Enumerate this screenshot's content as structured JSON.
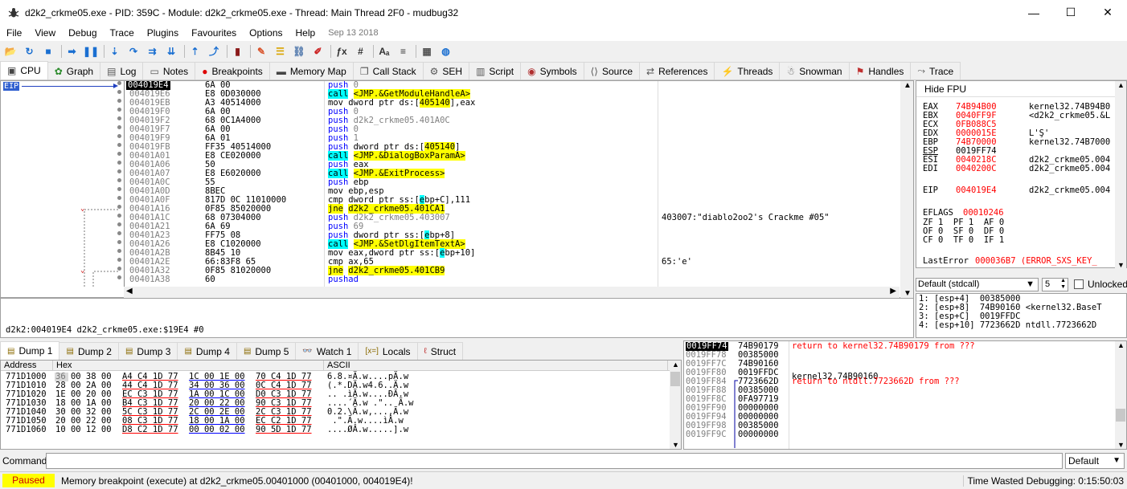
{
  "window": {
    "title": "d2k2_crkme05.exe - PID: 359C - Module: d2k2_crkme05.exe - Thread: Main Thread 2F0 - mudbug32",
    "min": "—",
    "max": "☐",
    "close": "✕"
  },
  "menu": [
    "File",
    "View",
    "Debug",
    "Trace",
    "Plugins",
    "Favourites",
    "Options",
    "Help"
  ],
  "menu_date": "Sep 13 2018",
  "toolbar": [
    {
      "name": "open-icon",
      "glyph": "📂",
      "color": "#d9a400"
    },
    {
      "name": "restart-icon",
      "glyph": "↻",
      "color": "#1a6fd1"
    },
    {
      "name": "stop-icon",
      "glyph": "■",
      "color": "#1a6fd1"
    },
    {
      "name": "run-icon",
      "glyph": "➡",
      "color": "#1a6fd1"
    },
    {
      "name": "pause-icon",
      "glyph": "❚❚",
      "color": "#1a6fd1"
    },
    {
      "name": "step-into-icon",
      "glyph": "⇣",
      "color": "#1a6fd1"
    },
    {
      "name": "step-over-icon",
      "glyph": "↷",
      "color": "#1a6fd1"
    },
    {
      "name": "trace-into-icon",
      "glyph": "⇉",
      "color": "#1a6fd1"
    },
    {
      "name": "trace-over-icon",
      "glyph": "⇊",
      "color": "#1a6fd1"
    },
    {
      "name": "execute-till-return-icon",
      "glyph": "⇡",
      "color": "#1a6fd1"
    },
    {
      "name": "run-to-user-code-icon",
      "glyph": "⤴",
      "color": "#1a6fd1"
    },
    {
      "name": "scylla-icon",
      "glyph": "▮",
      "color": "#8b1a1a"
    },
    {
      "name": "patch-icon",
      "glyph": "✎",
      "color": "#d9532b"
    },
    {
      "name": "comments-icon",
      "glyph": "☰",
      "color": "#d9a400"
    },
    {
      "name": "labels-icon",
      "glyph": "⛓",
      "color": "#5a7fb0"
    },
    {
      "name": "bookmarks-icon",
      "glyph": "✐",
      "color": "#cc2222"
    },
    {
      "name": "functions-icon",
      "glyph": "ƒx",
      "color": "#333"
    },
    {
      "name": "hash-icon",
      "glyph": "#",
      "color": "#333"
    },
    {
      "name": "font-icon",
      "glyph": "Aₐ",
      "color": "#333"
    },
    {
      "name": "list-icon",
      "glyph": "≡",
      "color": "#333"
    },
    {
      "name": "calculator-icon",
      "glyph": "▦",
      "color": "#555"
    },
    {
      "name": "globe-icon",
      "glyph": "◍",
      "color": "#1a6fd1"
    }
  ],
  "tabs": [
    {
      "label": "CPU",
      "icon": "cpu-icon",
      "glyph": "▣",
      "color": "#444",
      "active": true
    },
    {
      "label": "Graph",
      "icon": "graph-icon",
      "glyph": "✿",
      "color": "#2a8a2a"
    },
    {
      "label": "Log",
      "icon": "log-icon",
      "glyph": "▤",
      "color": "#555"
    },
    {
      "label": "Notes",
      "icon": "notes-icon",
      "glyph": "▭",
      "color": "#555"
    },
    {
      "label": "Breakpoints",
      "icon": "breakpoint-icon",
      "glyph": "●",
      "color": "#d00"
    },
    {
      "label": "Memory Map",
      "icon": "memory-map-icon",
      "glyph": "▬",
      "color": "#444"
    },
    {
      "label": "Call Stack",
      "icon": "call-stack-icon",
      "glyph": "❐",
      "color": "#555"
    },
    {
      "label": "SEH",
      "icon": "seh-icon",
      "glyph": "⚙",
      "color": "#555"
    },
    {
      "label": "Script",
      "icon": "script-icon",
      "glyph": "▥",
      "color": "#555"
    },
    {
      "label": "Symbols",
      "icon": "symbols-icon",
      "glyph": "◉",
      "color": "#b03030"
    },
    {
      "label": "Source",
      "icon": "source-icon",
      "glyph": "⟨⟩",
      "color": "#555"
    },
    {
      "label": "References",
      "icon": "references-icon",
      "glyph": "⇄",
      "color": "#555"
    },
    {
      "label": "Threads",
      "icon": "threads-icon",
      "glyph": "⚡",
      "color": "#1a6fd1"
    },
    {
      "label": "Snowman",
      "icon": "snowman-icon",
      "glyph": "☃",
      "color": "#555"
    },
    {
      "label": "Handles",
      "icon": "handles-icon",
      "glyph": "⚑",
      "color": "#c03030"
    },
    {
      "label": "Trace",
      "icon": "trace-icon",
      "glyph": "⤳",
      "color": "#555"
    }
  ],
  "eip_label": "EIP",
  "disasm": [
    {
      "addr": "004019E4",
      "cur": true,
      "bytes": "6A 00",
      "ins": [
        [
          "push",
          "push"
        ],
        [
          "num",
          " 0"
        ]
      ]
    },
    {
      "addr": "004019E6",
      "bytes": "E8 0D030000",
      "ins": [
        [
          "callhl",
          "call"
        ],
        [
          "plain",
          " "
        ],
        [
          "sym",
          "<JMP.&GetModuleHandleA>"
        ]
      ]
    },
    {
      "addr": "004019EB",
      "bytes": "A3 40514000",
      "ins": [
        [
          "mov",
          "mov dword ptr ds:["
        ],
        [
          "brk",
          "405140"
        ],
        [
          "mov",
          "],eax"
        ]
      ]
    },
    {
      "addr": "004019F0",
      "bytes": "6A 00",
      "ins": [
        [
          "push",
          "push"
        ],
        [
          "num",
          " 0"
        ]
      ]
    },
    {
      "addr": "004019F2",
      "bytes": "68 0C1A4000",
      "ins": [
        [
          "push",
          "push"
        ],
        [
          "num",
          " d2k2_crkme05.401A0C"
        ]
      ]
    },
    {
      "addr": "004019F7",
      "bytes": "6A 00",
      "ins": [
        [
          "push",
          "push"
        ],
        [
          "num",
          " 0"
        ]
      ]
    },
    {
      "addr": "004019F9",
      "bytes": "6A 01",
      "ins": [
        [
          "push",
          "push"
        ],
        [
          "num",
          " 1"
        ]
      ]
    },
    {
      "addr": "004019FB",
      "bytes": "FF35 40514000",
      "ins": [
        [
          "push",
          "push"
        ],
        [
          "mov",
          " dword ptr ds:["
        ],
        [
          "brk",
          "405140"
        ],
        [
          "mov",
          "]"
        ]
      ]
    },
    {
      "addr": "00401A01",
      "bytes": "E8 CE020000",
      "ins": [
        [
          "callhl",
          "call"
        ],
        [
          "plain",
          " "
        ],
        [
          "sym",
          "<JMP.&DialogBoxParamA>"
        ]
      ]
    },
    {
      "addr": "00401A06",
      "bytes": "50",
      "ins": [
        [
          "push",
          "push"
        ],
        [
          "mov",
          " eax"
        ]
      ]
    },
    {
      "addr": "00401A07",
      "bytes": "E8 E6020000",
      "ins": [
        [
          "callhl",
          "call"
        ],
        [
          "plain",
          " "
        ],
        [
          "sym",
          "<JMP.&ExitProcess>"
        ]
      ]
    },
    {
      "addr": "00401A0C",
      "bytes": "55",
      "ins": [
        [
          "push",
          "push"
        ],
        [
          "mov",
          " ebp"
        ]
      ]
    },
    {
      "addr": "00401A0D",
      "bytes": "8BEC",
      "ins": [
        [
          "mov",
          "mov ebp,esp"
        ]
      ]
    },
    {
      "addr": "00401A0F",
      "bytes": "817D 0C 11010000",
      "ins": [
        [
          "mov",
          "cmp dword ptr ss:["
        ],
        [
          "callhl",
          "e"
        ],
        [
          "mov",
          "bp+C],111"
        ]
      ]
    },
    {
      "addr": "00401A16",
      "bytes": "0F85 85020000",
      "arrow": true,
      "ins": [
        [
          "jcc",
          "jne"
        ],
        [
          "plain",
          " "
        ],
        [
          "sym",
          "d2k2_crkme05.401CA1"
        ]
      ]
    },
    {
      "addr": "00401A1C",
      "bytes": "68 07304000",
      "ins": [
        [
          "push",
          "push"
        ],
        [
          "num",
          " d2k2_crkme05.403007"
        ]
      ],
      "cmt": "403007:\"diablo2oo2's Crackme #05\""
    },
    {
      "addr": "00401A21",
      "bytes": "6A 69",
      "ins": [
        [
          "push",
          "push"
        ],
        [
          "num",
          " 69"
        ]
      ]
    },
    {
      "addr": "00401A23",
      "bytes": "FF75 08",
      "ins": [
        [
          "push",
          "push"
        ],
        [
          "mov",
          " dword ptr ss:["
        ],
        [
          "callhl",
          "e"
        ],
        [
          "mov",
          "bp+8]"
        ]
      ]
    },
    {
      "addr": "00401A26",
      "bytes": "E8 C1020000",
      "ins": [
        [
          "callhl",
          "call"
        ],
        [
          "plain",
          " "
        ],
        [
          "sym",
          "<JMP.&SetDlgItemTextA>"
        ]
      ]
    },
    {
      "addr": "00401A2B",
      "bytes": "8B45 10",
      "ins": [
        [
          "mov",
          "mov eax,dword ptr ss:["
        ],
        [
          "callhl",
          "e"
        ],
        [
          "mov",
          "bp+10]"
        ]
      ]
    },
    {
      "addr": "00401A2E",
      "bytes": "66:83F8 65",
      "ins": [
        [
          "mov",
          "cmp ax,65"
        ]
      ],
      "cmt": "65:'e'"
    },
    {
      "addr": "00401A32",
      "bytes": "0F85 81020000",
      "arrow": true,
      "ins": [
        [
          "jcc",
          "jne"
        ],
        [
          "plain",
          " "
        ],
        [
          "sym",
          "d2k2_crkme05.401CB9"
        ]
      ]
    },
    {
      "addr": "00401A38",
      "bytes": "60",
      "ins": [
        [
          "push",
          "pushad"
        ]
      ]
    }
  ],
  "regs": {
    "hide_fpu": "Hide FPU",
    "rows": [
      {
        "n": "EAX",
        "v": "74B94B00",
        "d": "kernel32.74B94B0",
        "red": true
      },
      {
        "n": "EBX",
        "v": "0040FF9F",
        "d": "<d2k2_crkme05.&L",
        "red": true
      },
      {
        "n": "ECX",
        "v": "0FB088C5",
        "d": "",
        "red": true
      },
      {
        "n": "EDX",
        "v": "0000015E",
        "d": "L'Ş'",
        "red": true
      },
      {
        "n": "EBP",
        "v": "74B70000",
        "d": "kernel32.74B7000",
        "red": true
      },
      {
        "n": "ESP",
        "v": "0019FF74",
        "d": "",
        "red": false
      },
      {
        "n": "ESI",
        "v": "0040218C",
        "d": "d2k2_crkme05.004",
        "red": true
      },
      {
        "n": "EDI",
        "v": "0040200C",
        "d": "d2k2_crkme05.004",
        "red": true
      },
      {
        "n": "EIP",
        "v": "004019E4",
        "d": "d2k2_crkme05.004",
        "red": true
      }
    ],
    "eflags_name": "EFLAGS",
    "eflags_val": "00010246",
    "flags": [
      "ZF 1  PF 1  AF 0",
      "OF 0  SF 0  DF 0",
      "CF 0  TF 0  IF 1"
    ],
    "lasterror_name": "LastError",
    "lasterror_val": "000036B7 (ERROR_SXS_KEY_"
  },
  "callconv": {
    "selected": "Default (stdcall)",
    "count": "5",
    "unlocked": "Unlocked"
  },
  "args": [
    "1: [esp+4]  00385000",
    "2: [esp+8]  74B90160 <kernel32.BaseT",
    "3: [esp+C]  0019FFDC",
    "4: [esp+10] 7723662D ntdll.7723662D"
  ],
  "info_text": "d2k2:004019E4 d2k2_crkme05.exe:$19E4 #0",
  "dump_tabs": [
    {
      "label": "Dump 1",
      "active": true
    },
    {
      "label": "Dump 2"
    },
    {
      "label": "Dump 3"
    },
    {
      "label": "Dump 4"
    },
    {
      "label": "Dump 5"
    },
    {
      "label": "Watch 1"
    },
    {
      "label": "Locals",
      "icon": "locals-icon"
    },
    {
      "label": "Struct",
      "icon": "struct-icon"
    }
  ],
  "dump": {
    "headers": [
      "Address",
      "Hex",
      "ASCII"
    ],
    "rows": [
      {
        "a": "771D1000",
        "h": [
          "36 00 38 00",
          "A4 C4 1D 77",
          "1C 00 1E 00",
          "70 C4 1D 77"
        ],
        "s": "6.8.¤Ä.w....pÄ.w"
      },
      {
        "a": "771D1010",
        "h": [
          "28 00 2A 00",
          "44 C4 1D 77",
          "34 00 36 00",
          "0C C4 1D 77"
        ],
        "s": "(.*.DÄ.w4.6..Ä.w"
      },
      {
        "a": "771D1020",
        "h": [
          "1E 00 20 00",
          "EC C3 1D 77",
          "1A 00 1C 00",
          "D0 C3 1D 77"
        ],
        "s": ".. .ìÃ.w....ÐÃ.w"
      },
      {
        "a": "771D1030",
        "h": [
          "18 00 1A 00",
          "B4 C3 1D 77",
          "20 00 22 00",
          "90 C3 1D 77"
        ],
        "s": "....´Ã.w .\".. Ã.w"
      },
      {
        "a": "771D1040",
        "h": [
          "30 00 32 00",
          "5C C3 1D 77",
          "2C 00 2E 00",
          "2C C3 1D 77"
        ],
        "s": "0.2.\\Ã.w,...,Ã.w"
      },
      {
        "a": "771D1050",
        "h": [
          "20 00 22 00",
          "08 C3 1D 77",
          "18 00 1A 00",
          "EC C2 1D 77"
        ],
        "s": " .\".Ã.w....ìÂ.w"
      },
      {
        "a": "771D1060",
        "h": [
          "10 00 12 00",
          "D8 C2 1D 77",
          "00 00 02 00",
          "90 5D 1D 77"
        ],
        "s": "....ØÂ.w.....].w"
      }
    ]
  },
  "stack": [
    {
      "a": "0019FF74",
      "v": "74B90179",
      "c": "return to kernel32.74B90179 from ???",
      "cur": true,
      "red": true
    },
    {
      "a": "0019FF78",
      "v": "00385000",
      "c": ""
    },
    {
      "a": "0019FF7C",
      "v": "74B90160",
      "c": "kernel32.74B90160",
      "red": false
    },
    {
      "a": "0019FF80",
      "v": "0019FFDC",
      "c": ""
    },
    {
      "a": "0019FF84",
      "v": "7723662D",
      "c": "return to ntdll.7723662D from ???",
      "red": true
    },
    {
      "a": "0019FF88",
      "v": "00385000",
      "c": ""
    },
    {
      "a": "0019FF8C",
      "v": "0FA97719",
      "c": ""
    },
    {
      "a": "0019FF90",
      "v": "00000000",
      "c": ""
    },
    {
      "a": "0019FF94",
      "v": "00000000",
      "c": ""
    },
    {
      "a": "0019FF98",
      "v": "00385000",
      "c": ""
    },
    {
      "a": "0019FF9C",
      "v": "00000000",
      "c": ""
    }
  ],
  "command": {
    "label": "Command:",
    "value": "",
    "default": "Default"
  },
  "status": {
    "state": "Paused",
    "message": "Memory breakpoint (execute) at d2k2_crkme05.00401000 (00401000, 004019E4)!",
    "time": "Time Wasted Debugging: 0:15:50:03"
  }
}
